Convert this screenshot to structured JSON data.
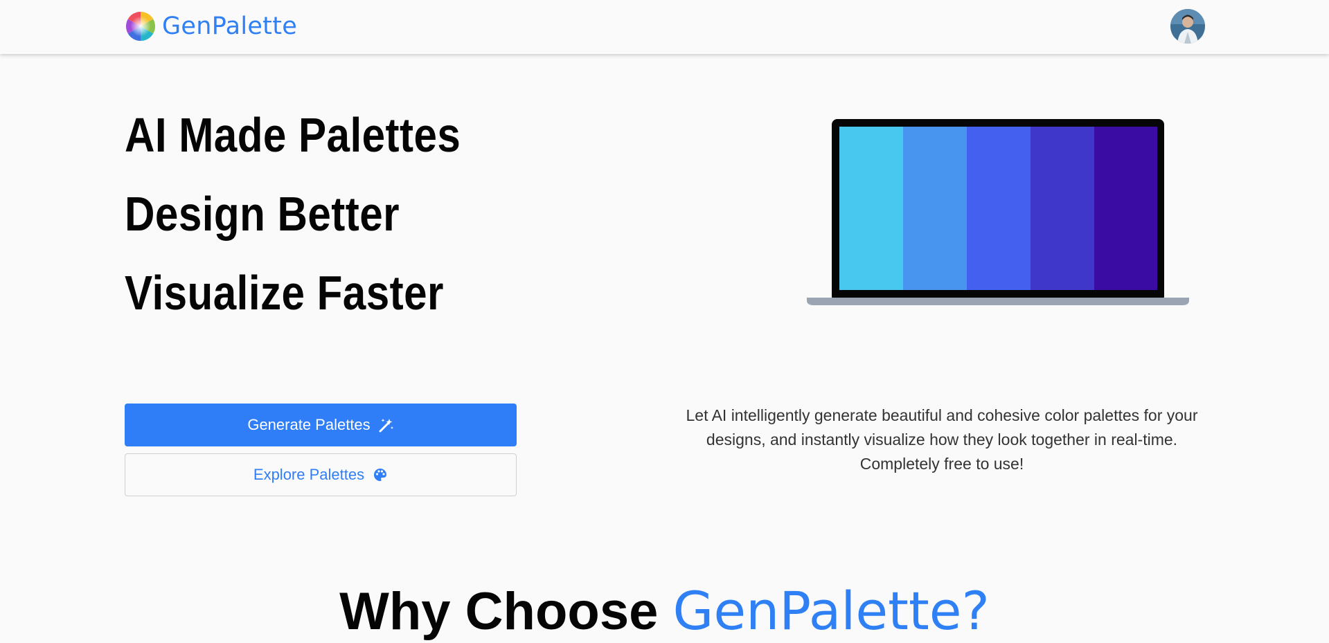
{
  "navbar": {
    "brand_name": "GenPalette",
    "logo_icon": "color-wheel-icon",
    "avatar_icon": "user-avatar"
  },
  "hero": {
    "title_lines": [
      "AI Made Palettes",
      "Design Better",
      "Visualize Faster"
    ],
    "description": "Let AI intelligently generate beautiful and cohesive color palettes for your designs, and instantly visualize how they look together in real-time. Completely free to use!",
    "primary_button": {
      "label": "Generate Palettes",
      "icon": "magic-wand-icon"
    },
    "secondary_button": {
      "label": "Explore Palettes",
      "icon": "palette-icon"
    },
    "preview_palette": [
      "#48c7ef",
      "#4895ef",
      "#4361ee",
      "#3f37c9",
      "#3a0ca3"
    ]
  },
  "section": {
    "heading_prefix": "Why Choose ",
    "heading_accent": "GenPalette?"
  },
  "colors": {
    "accent": "#2f7ef7",
    "brand_text": "#2f80f4",
    "background": "#fafafa"
  }
}
